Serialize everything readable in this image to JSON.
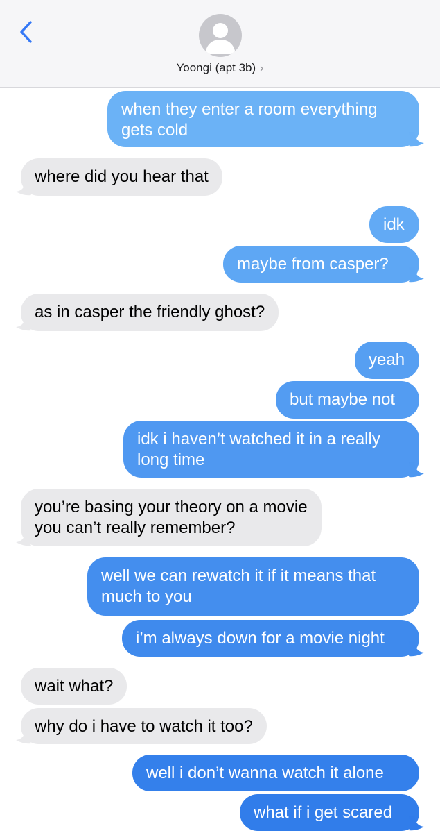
{
  "header": {
    "contact_name": "Yoongi (apt 3b)",
    "back_icon": "chevron-left-icon",
    "avatar_icon": "person-silhouette-icon",
    "detail_icon": "chevron-right-icon"
  },
  "colors": {
    "outgoing_top": "#6db4f7",
    "outgoing_bottom": "#2f7bea",
    "incoming": "#e9e9eb",
    "accent": "#3478f6"
  },
  "messages": [
    {
      "id": 0,
      "sender": "me",
      "lines": [
        "when they enter a room everything",
        "gets cold"
      ]
    },
    {
      "id": 1,
      "sender": "them",
      "lines": [
        "where did you hear that"
      ]
    },
    {
      "id": 2,
      "sender": "me",
      "lines": [
        "idk"
      ]
    },
    {
      "id": 3,
      "sender": "me",
      "lines": [
        "maybe from casper?"
      ]
    },
    {
      "id": 4,
      "sender": "them",
      "lines": [
        "as in casper the friendly ghost?"
      ]
    },
    {
      "id": 5,
      "sender": "me",
      "lines": [
        "yeah"
      ]
    },
    {
      "id": 6,
      "sender": "me",
      "lines": [
        "but maybe not"
      ]
    },
    {
      "id": 7,
      "sender": "me",
      "lines": [
        "idk i haven’t watched it in a really",
        "long time"
      ]
    },
    {
      "id": 8,
      "sender": "them",
      "lines": [
        "you’re basing your theory on a movie",
        "you can’t really remember?"
      ]
    },
    {
      "id": 9,
      "sender": "me",
      "lines": [
        "well we can rewatch it if it means that",
        "much to you"
      ]
    },
    {
      "id": 10,
      "sender": "me",
      "lines": [
        "i’m always down for a movie night"
      ]
    },
    {
      "id": 11,
      "sender": "them",
      "lines": [
        "wait what?"
      ]
    },
    {
      "id": 12,
      "sender": "them",
      "lines": [
        "why do i have to watch it too?"
      ]
    },
    {
      "id": 13,
      "sender": "me",
      "lines": [
        "well i don’t wanna watch it alone"
      ]
    },
    {
      "id": 14,
      "sender": "me",
      "lines": [
        "what if i get scared"
      ]
    }
  ]
}
